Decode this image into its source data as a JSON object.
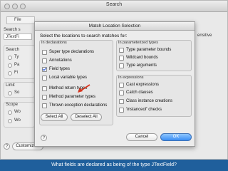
{
  "background_window": {
    "title": "Search",
    "tab_label": "File",
    "search_string_label": "Search s",
    "search_string_value": "JTextFi",
    "sensitive_label": "ensitive",
    "search_for_label": "Search",
    "limit_to_label": "Limit",
    "scope_label": "Scope",
    "radio_labels": [
      "Ty",
      "Pa",
      "Fi",
      "So",
      "Wo",
      "Wo"
    ],
    "customize_button": "Customize..."
  },
  "dialog": {
    "title": "Match Location Selection",
    "instruction": "Select the locations to search matches for:",
    "groups": {
      "declarations": {
        "label": "In declarations",
        "items": [
          {
            "label": "Super type declarations",
            "checked": false
          },
          {
            "label": "Annotations",
            "checked": false
          },
          {
            "label": "Field types",
            "checked": true
          },
          {
            "label": "Local variable types",
            "checked": false
          },
          {
            "label": "Method return types",
            "checked": false
          },
          {
            "label": "Method parameter types",
            "checked": false
          },
          {
            "label": "Thrown exception declarations",
            "checked": false
          }
        ]
      },
      "parameterized": {
        "label": "In parameterized types",
        "items": [
          {
            "label": "Type parameter bounds",
            "checked": false
          },
          {
            "label": "Wildcard bounds",
            "checked": false
          },
          {
            "label": "Type arguments",
            "checked": false
          }
        ]
      },
      "expressions": {
        "label": "In expressions",
        "items": [
          {
            "label": "Cast expressions",
            "checked": false
          },
          {
            "label": "Catch clauses",
            "checked": false
          },
          {
            "label": "Class instance creations",
            "checked": false
          },
          {
            "label": "'instanceof' checks",
            "checked": false
          }
        ]
      }
    },
    "select_all_label": "Select All",
    "deselect_all_label": "Deselect All",
    "cancel_label": "Cancel",
    "ok_label": "OK",
    "help_label": "?"
  },
  "caption": "What fields are declared as being of the type JTextField?",
  "colors": {
    "caption_bg": "#1f5f9c",
    "arrow": "#d8361f",
    "default_button": "#3b8ef3"
  }
}
